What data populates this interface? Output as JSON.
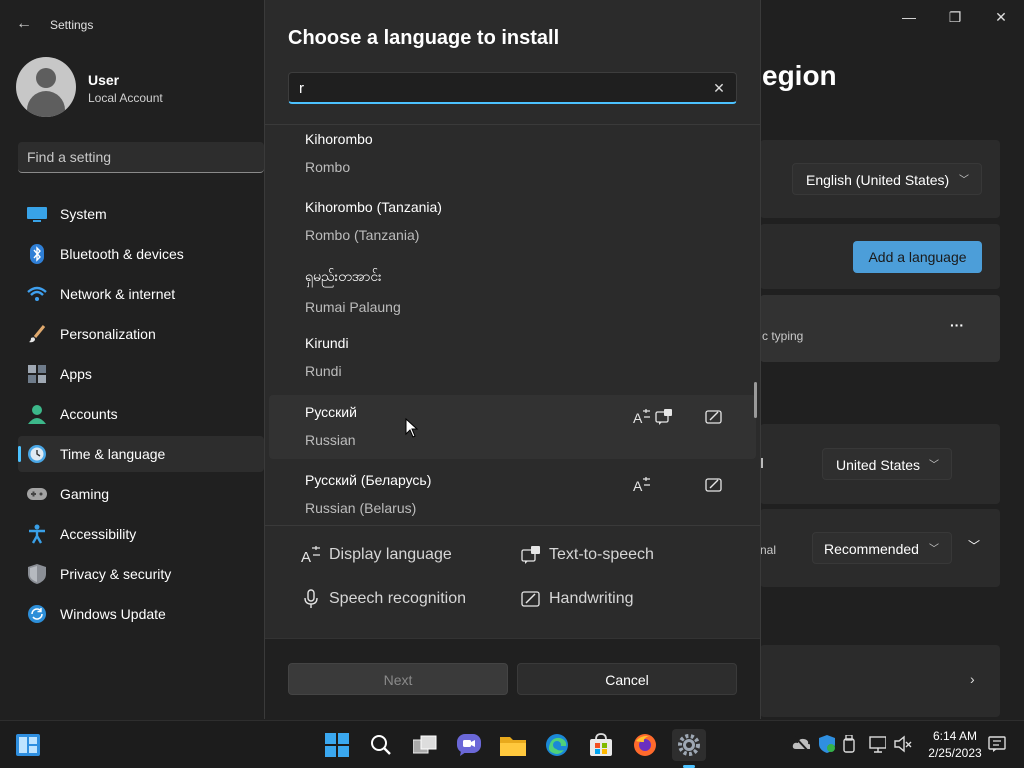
{
  "window": {
    "title": "Settings",
    "heading_partial": "egion",
    "minimize": "—",
    "maximize": "❐",
    "close": "✕"
  },
  "user": {
    "name": "User",
    "account": "Local Account"
  },
  "search": {
    "placeholder": "Find a setting"
  },
  "sidebar": {
    "items": [
      {
        "label": "System",
        "icon": "system-icon"
      },
      {
        "label": "Bluetooth & devices",
        "icon": "bluetooth-icon"
      },
      {
        "label": "Network & internet",
        "icon": "network-icon"
      },
      {
        "label": "Personalization",
        "icon": "brush-icon"
      },
      {
        "label": "Apps",
        "icon": "apps-icon"
      },
      {
        "label": "Accounts",
        "icon": "account-icon"
      },
      {
        "label": "Time & language",
        "icon": "clock-icon",
        "active": true
      },
      {
        "label": "Gaming",
        "icon": "gamepad-icon"
      },
      {
        "label": "Accessibility",
        "icon": "accessibility-icon"
      },
      {
        "label": "Privacy & security",
        "icon": "shield-icon"
      },
      {
        "label": "Windows Update",
        "icon": "update-icon"
      }
    ]
  },
  "background": {
    "windows_display_language": "English (United States)",
    "add_language": "Add a language",
    "typing_partial": "c typing",
    "more": "···",
    "region_value": "United States",
    "format_partial": "nal",
    "format_value": "Recommended"
  },
  "dialog": {
    "title": "Choose a language to install",
    "search_value": "r",
    "languages": [
      {
        "native": "Kihorombo",
        "english": "Rombo",
        "features": []
      },
      {
        "native": "Kihorombo (Tanzania)",
        "english": "Rombo (Tanzania)",
        "features": []
      },
      {
        "native": "ရှမည်းတအာင်း",
        "english": "Rumai Palaung",
        "features": []
      },
      {
        "native": "Kirundi",
        "english": "Rundi",
        "features": []
      },
      {
        "native": "Русский",
        "english": "Russian",
        "features": [
          "display-language",
          "text-to-speech",
          "handwriting"
        ]
      },
      {
        "native": "Русский (Беларусь)",
        "english": "Russian (Belarus)",
        "features": [
          "display-language",
          "handwriting"
        ]
      }
    ],
    "legend": {
      "display_language": "Display language",
      "text_to_speech": "Text-to-speech",
      "speech_recognition": "Speech recognition",
      "handwriting": "Handwriting"
    },
    "next": "Next",
    "cancel": "Cancel"
  },
  "taskbar": {
    "time": "6:14 AM",
    "date": "2/25/2023"
  },
  "colors": {
    "accent": "#4cc2ff",
    "button_accent": "#4c9ed9"
  }
}
